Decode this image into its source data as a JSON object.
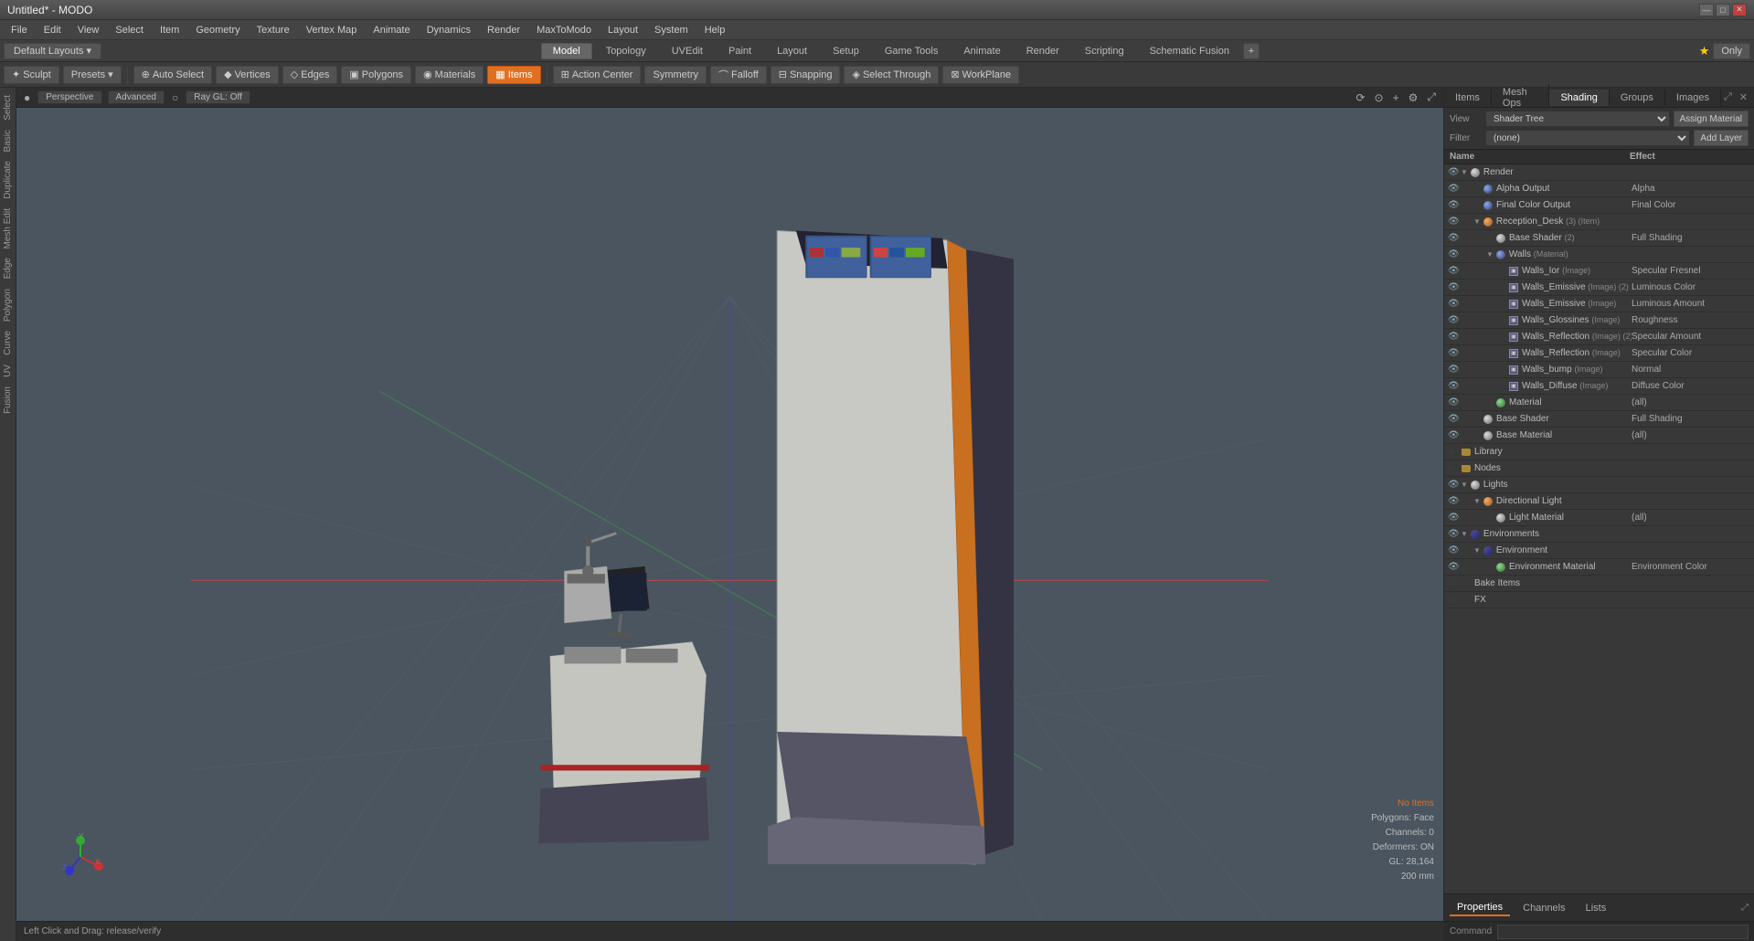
{
  "window": {
    "title": "Untitled* - MODO"
  },
  "titlebar": {
    "title": "Untitled* - MODO",
    "minimize": "—",
    "maximize": "□",
    "close": "✕"
  },
  "menubar": {
    "items": [
      "File",
      "Edit",
      "View",
      "Select",
      "Item",
      "Geometry",
      "Texture",
      "Vertex Map",
      "Animate",
      "Dynamics",
      "Render",
      "MaxToModo",
      "Layout",
      "System",
      "Help"
    ]
  },
  "toolbar1": {
    "layout_btn": "Default Layouts ▾",
    "tabs": [
      "Model",
      "Topology",
      "UVEdit",
      "Paint",
      "Layout",
      "Setup",
      "Game Tools",
      "Animate",
      "Render",
      "Scripting",
      "Schematic Fusion"
    ],
    "active_tab": "Model",
    "star": "★",
    "only": "Only"
  },
  "toolbar2": {
    "sculpt": "Sculpt",
    "presets": "Presets",
    "presets_count": "▾",
    "auto_select": "Auto Select",
    "vertices": "Vertices",
    "edges": "Edges",
    "polygons": "Polygons",
    "materials": "Materials",
    "items": "Items",
    "action_center": "Action Center",
    "symmetry": "Symmetry",
    "falloff": "Falloff",
    "snapping": "Snapping",
    "select_through": "Select Through",
    "workplane": "WorkPlane"
  },
  "viewport": {
    "view_type": "Perspective",
    "advanced": "Advanced",
    "ray_gl": "Ray GL: Off"
  },
  "status": {
    "mouse_action": "Left Click and Drag:  release/verify",
    "no_items": "No Items",
    "polygons": "Polygons: Face",
    "channels": "Channels: 0",
    "deformers": "Deformers: ON",
    "gl": "GL: 28,164",
    "scale": "200 mm"
  },
  "right_panel": {
    "tabs": [
      "Items",
      "Mesh Ops",
      "Shading",
      "Groups",
      "Images"
    ],
    "active_tab": "Shading",
    "view_label": "View",
    "view_value": "Shader Tree",
    "assign_material": "Assign Material",
    "filter_label": "Filter",
    "filter_value": "(none)",
    "add_layer": "Add Layer",
    "col_name": "Name",
    "col_effect": "Effect"
  },
  "shader_tree": {
    "rows": [
      {
        "indent": 0,
        "icon": "sphere",
        "name": "Render",
        "type": "",
        "effect": "",
        "eye": true,
        "visible": true
      },
      {
        "indent": 1,
        "icon": "sphere-blue",
        "name": "Alpha Output",
        "type": "",
        "effect": "Alpha",
        "eye": true,
        "visible": true
      },
      {
        "indent": 1,
        "icon": "sphere-blue",
        "name": "Final Color Output",
        "type": "",
        "effect": "Final Color",
        "eye": true,
        "visible": true
      },
      {
        "indent": 1,
        "icon": "sphere-orange",
        "name": "Reception_Desk",
        "type": "(3) (Item)",
        "effect": "",
        "eye": true,
        "visible": true
      },
      {
        "indent": 2,
        "icon": "sphere",
        "name": "Base Shader",
        "type": "(2)",
        "effect": "Full Shading",
        "eye": true,
        "visible": true
      },
      {
        "indent": 2,
        "icon": "sphere-blue",
        "name": "Walls",
        "type": "(Material)",
        "effect": "",
        "eye": true,
        "visible": true
      },
      {
        "indent": 3,
        "icon": "image",
        "name": "Walls_Ior",
        "type": "(Image)",
        "effect": "Specular Fresnel",
        "eye": true,
        "visible": true
      },
      {
        "indent": 3,
        "icon": "image",
        "name": "Walls_Emissive",
        "type": "(Image) (2)",
        "effect": "Luminous Color",
        "eye": true,
        "visible": true
      },
      {
        "indent": 3,
        "icon": "image",
        "name": "Walls_Emissive",
        "type": "(Image)",
        "effect": "Luminous Amount",
        "eye": true,
        "visible": true
      },
      {
        "indent": 3,
        "icon": "image",
        "name": "Walls_Glossines",
        "type": "(Image)",
        "effect": "Roughness",
        "eye": true,
        "visible": true
      },
      {
        "indent": 3,
        "icon": "image",
        "name": "Walls_Reflection",
        "type": "(Image) (2)",
        "effect": "Specular Amount",
        "eye": true,
        "visible": true
      },
      {
        "indent": 3,
        "icon": "image",
        "name": "Walls_Reflection",
        "type": "(Image)",
        "effect": "Specular Color",
        "eye": true,
        "visible": true
      },
      {
        "indent": 3,
        "icon": "image",
        "name": "Walls_bump",
        "type": "(Image)",
        "effect": "Normal",
        "eye": true,
        "visible": true
      },
      {
        "indent": 3,
        "icon": "image",
        "name": "Walls_Diffuse",
        "type": "(Image)",
        "effect": "Diffuse Color",
        "eye": true,
        "visible": true
      },
      {
        "indent": 2,
        "icon": "sphere-green",
        "name": "Material",
        "type": "",
        "effect": "(all)",
        "eye": true,
        "visible": true
      },
      {
        "indent": 1,
        "icon": "sphere",
        "name": "Base Shader",
        "type": "",
        "effect": "Full Shading",
        "eye": true,
        "visible": true
      },
      {
        "indent": 1,
        "icon": "sphere",
        "name": "Base Material",
        "type": "",
        "effect": "(all)",
        "eye": true,
        "visible": true
      },
      {
        "indent": 0,
        "icon": "folder",
        "name": "Library",
        "type": "",
        "effect": "",
        "eye": false,
        "visible": true
      },
      {
        "indent": 0,
        "icon": "folder",
        "name": "Nodes",
        "type": "",
        "effect": "",
        "eye": false,
        "visible": true
      },
      {
        "indent": 0,
        "icon": "sphere",
        "name": "Lights",
        "type": "",
        "effect": "",
        "eye": true,
        "visible": true
      },
      {
        "indent": 1,
        "icon": "sphere-orange",
        "name": "Directional Light",
        "type": "",
        "effect": "",
        "eye": true,
        "visible": true
      },
      {
        "indent": 2,
        "icon": "sphere",
        "name": "Light Material",
        "type": "",
        "effect": "(all)",
        "eye": true,
        "visible": true
      },
      {
        "indent": 0,
        "icon": "env",
        "name": "Environments",
        "type": "",
        "effect": "",
        "eye": true,
        "visible": true
      },
      {
        "indent": 1,
        "icon": "env",
        "name": "Environment",
        "type": "",
        "effect": "",
        "eye": true,
        "visible": true
      },
      {
        "indent": 2,
        "icon": "sphere-green",
        "name": "Environment Material",
        "type": "",
        "effect": "Environment Color",
        "eye": true,
        "visible": true
      },
      {
        "indent": 0,
        "icon": "none",
        "name": "Bake Items",
        "type": "",
        "effect": "",
        "eye": false,
        "visible": true
      },
      {
        "indent": 0,
        "icon": "none",
        "name": "FX",
        "type": "",
        "effect": "",
        "eye": false,
        "visible": true
      }
    ]
  },
  "bottom_right": {
    "tabs": [
      "Properties",
      "Channels",
      "Lists"
    ],
    "active_tab": "Properties",
    "command_label": "Command"
  },
  "colors": {
    "accent": "#e07020",
    "bg_dark": "#2e2e2e",
    "bg_mid": "#3a3a3a",
    "bg_light": "#4a4a4a",
    "viewport_bg": "#4a5560"
  }
}
